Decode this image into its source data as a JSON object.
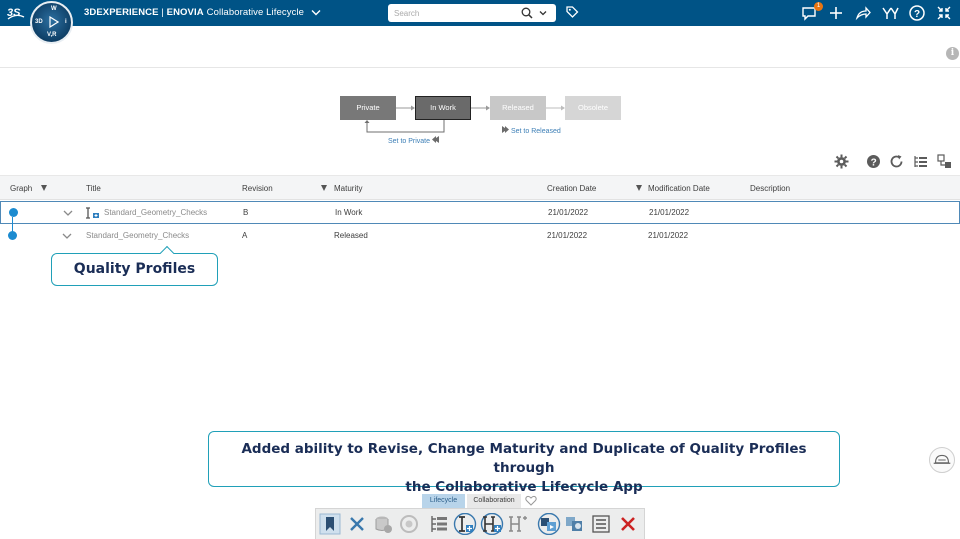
{
  "topbar": {
    "brand_prefix": "3DEXPERIENCE",
    "brand_separator": " | ",
    "brand_product": "ENOVIA",
    "app_name": "Collaborative Lifecycle",
    "search_placeholder": "Search",
    "notification_count": "1",
    "compass_labels": {
      "left": "3D",
      "top": "W",
      "right": "i",
      "bottom": "V,R"
    },
    "colors": {
      "bar": "#005386",
      "badge": "#e87511"
    }
  },
  "lifecycle": {
    "states": [
      "Private",
      "In Work",
      "Released",
      "Obsolete"
    ],
    "current_state": "In Work",
    "transitions": {
      "back": "Set to Private",
      "forward": "Set to Released"
    }
  },
  "table": {
    "columns": [
      "Graph",
      "Title",
      "Revision",
      "Maturity",
      "Creation Date",
      "Modification Date",
      "Description"
    ],
    "rows": [
      {
        "title": "Standard_Geometry_Checks",
        "revision": "B",
        "maturity": "In Work",
        "created": "21/01/2022",
        "modified": "21/01/2022",
        "description": "",
        "selected": true
      },
      {
        "title": "Standard_Geometry_Checks",
        "revision": "A",
        "maturity": "Released",
        "created": "21/01/2022",
        "modified": "21/01/2022",
        "description": "",
        "selected": false
      }
    ]
  },
  "callouts": {
    "small": "Quality Profiles",
    "big_line1": "Added ability to Revise, Change Maturity and Duplicate of Quality Profiles through",
    "big_line2": "the Collaborative Lifecycle App"
  },
  "action_bar": {
    "tabs": [
      "Lifecycle",
      "Collaboration"
    ],
    "active_tab": "Lifecycle",
    "icons": [
      "bookmark-icon",
      "cancel-icon",
      "database-icon",
      "settings-wheel-icon",
      "tree-structure-icon",
      "revise-icon",
      "duplicate-icon",
      "branch-icon",
      "change-maturity-icon",
      "lifecycle-config-icon",
      "list-icon",
      "close-red-icon"
    ]
  }
}
